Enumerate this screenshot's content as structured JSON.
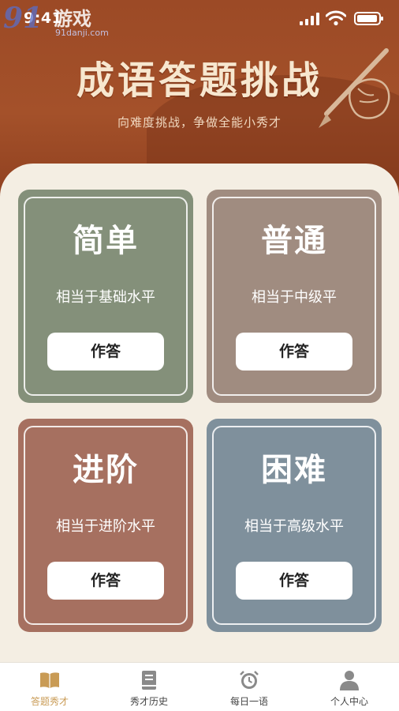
{
  "status_bar": {
    "time": "9:41",
    "watermark_logo": "91",
    "watermark_text": "游戏",
    "watermark_site": "91danji.com"
  },
  "header": {
    "title": "成语答题挑战",
    "subtitle": "向难度挑战，争做全能小秀才"
  },
  "levels": [
    {
      "name": "简单",
      "desc": "相当于基础水平",
      "button": "作答",
      "color": "#84907a"
    },
    {
      "name": "普通",
      "desc": "相当于中级平",
      "button": "作答",
      "color": "#a08c80"
    },
    {
      "name": "进阶",
      "desc": "相当于进阶水平",
      "button": "作答",
      "color": "#a67060"
    },
    {
      "name": "困难",
      "desc": "相当于高级水平",
      "button": "作答",
      "color": "#7f909c"
    }
  ],
  "tabbar": {
    "items": [
      {
        "label": "答题秀才",
        "icon": "book-icon",
        "active": true
      },
      {
        "label": "秀才历史",
        "icon": "history-book-icon",
        "active": false
      },
      {
        "label": "每日一语",
        "icon": "alarm-clock-icon",
        "active": false
      },
      {
        "label": "个人中心",
        "icon": "user-icon",
        "active": false
      }
    ]
  },
  "colors": {
    "header_bg": "#a04e28",
    "page_bg": "#f4eee3",
    "tab_active": "#c99b55",
    "tab_inactive": "#8a8a8a"
  }
}
